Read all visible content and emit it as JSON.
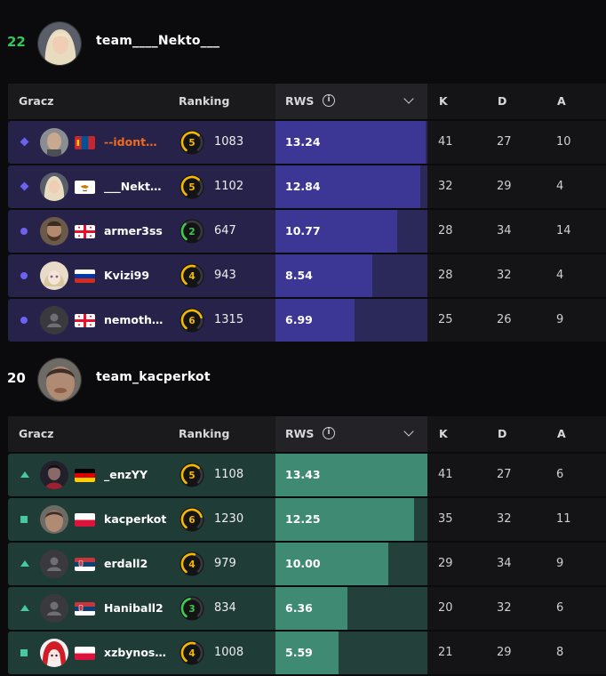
{
  "colors": {
    "team1_row": "#26224a",
    "team1_rws_bg": "#2b285a",
    "team1_rws_bar": "#3c3794",
    "team1_marker": "#6b62f0",
    "team2_row": "#1f3c36",
    "team2_rws_bg": "#23403a",
    "team2_rws_bar": "#3f8a72",
    "team2_marker": "#48c8a0",
    "score_win": "#32c75b",
    "nick_highlight": "#f26b1d"
  },
  "headers": {
    "player": "Gracz",
    "ranking": "Ranking",
    "rws": "RWS",
    "k": "K",
    "d": "D",
    "a": "A"
  },
  "teams": [
    {
      "score": "22",
      "name": "team____Nekto___",
      "players": [
        {
          "marker": "diamond",
          "flag": "mongolia",
          "nick": "--idont…",
          "highlight": true,
          "level": "5",
          "elo": "1083",
          "rws": "13.24",
          "rws_value": 13.24,
          "k": "41",
          "d": "27",
          "a": "10",
          "avatar": "bald"
        },
        {
          "marker": "diamond",
          "flag": "cyprus",
          "nick": "___Nekt…",
          "highlight": false,
          "level": "5",
          "elo": "1102",
          "rws": "12.84",
          "rws_value": 12.84,
          "k": "32",
          "d": "29",
          "a": "4",
          "avatar": "blonde"
        },
        {
          "marker": "dot",
          "flag": "georgia",
          "nick": "armer3ss",
          "highlight": false,
          "level": "2",
          "elo": "647",
          "rws": "10.77",
          "rws_value": 10.77,
          "k": "28",
          "d": "34",
          "a": "14",
          "avatar": "beard"
        },
        {
          "marker": "dot",
          "flag": "russia",
          "nick": "Kvizi99",
          "highlight": false,
          "level": "4",
          "elo": "943",
          "rws": "8.54",
          "rws_value": 8.54,
          "k": "28",
          "d": "32",
          "a": "4",
          "avatar": "anime"
        },
        {
          "marker": "dot",
          "flag": "georgia",
          "nick": "nemoth…",
          "highlight": false,
          "level": "6",
          "elo": "1315",
          "rws": "6.99",
          "rws_value": 6.99,
          "k": "25",
          "d": "26",
          "a": "9",
          "avatar": "default"
        }
      ]
    },
    {
      "score": "20",
      "name": "team_kacperkot",
      "players": [
        {
          "marker": "triangle",
          "flag": "germany",
          "nick": "_enzYY",
          "highlight": false,
          "level": "5",
          "elo": "1108",
          "rws": "13.43",
          "rws_value": 13.43,
          "k": "41",
          "d": "27",
          "a": "6",
          "avatar": "dark"
        },
        {
          "marker": "square",
          "flag": "poland",
          "nick": "kacperkot",
          "highlight": false,
          "level": "6",
          "elo": "1230",
          "rws": "12.25",
          "rws_value": 12.25,
          "k": "35",
          "d": "32",
          "a": "11",
          "avatar": "face"
        },
        {
          "marker": "triangle",
          "flag": "serbia",
          "nick": "erdall2",
          "highlight": false,
          "level": "4",
          "elo": "979",
          "rws": "10.00",
          "rws_value": 10.0,
          "k": "29",
          "d": "34",
          "a": "9",
          "avatar": "default"
        },
        {
          "marker": "triangle",
          "flag": "serbia",
          "nick": "Haniball2",
          "highlight": false,
          "level": "3",
          "elo": "834",
          "rws": "6.36",
          "rws_value": 6.36,
          "k": "20",
          "d": "32",
          "a": "6",
          "avatar": "default"
        },
        {
          "marker": "square",
          "flag": "poland",
          "nick": "xzbynos…",
          "highlight": false,
          "level": "4",
          "elo": "1008",
          "rws": "5.59",
          "rws_value": 5.59,
          "k": "21",
          "d": "29",
          "a": "8",
          "avatar": "red"
        }
      ]
    }
  ]
}
